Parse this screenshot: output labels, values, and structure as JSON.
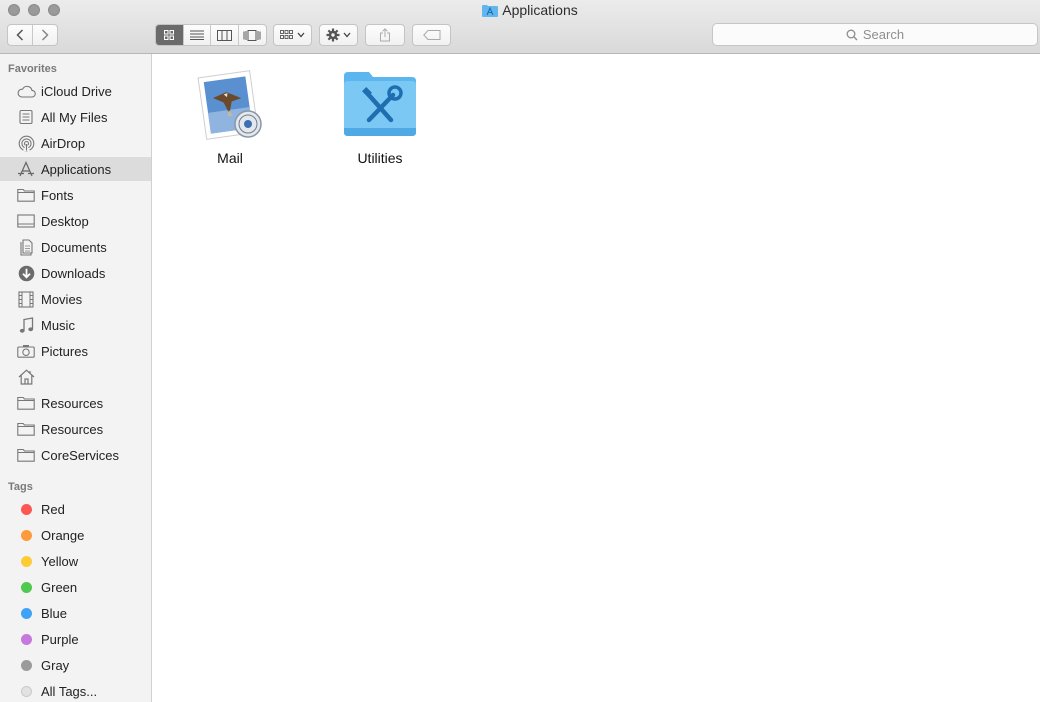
{
  "window": {
    "title": "Applications"
  },
  "toolbar": {
    "search_placeholder": "Search",
    "view_modes": [
      "icon-view",
      "list-view",
      "column-view",
      "cover-flow-view"
    ]
  },
  "sidebar": {
    "favorites_title": "Favorites",
    "favorites": [
      {
        "label": "iCloud Drive",
        "icon": "cloud-icon"
      },
      {
        "label": "All My Files",
        "icon": "all-files-icon"
      },
      {
        "label": "AirDrop",
        "icon": "airdrop-icon"
      },
      {
        "label": "Applications",
        "icon": "applications-icon",
        "selected": true
      },
      {
        "label": "Fonts",
        "icon": "folder-icon"
      },
      {
        "label": "Desktop",
        "icon": "desktop-icon"
      },
      {
        "label": "Documents",
        "icon": "documents-icon"
      },
      {
        "label": "Downloads",
        "icon": "downloads-icon"
      },
      {
        "label": "Movies",
        "icon": "movies-icon"
      },
      {
        "label": "Music",
        "icon": "music-icon"
      },
      {
        "label": "Pictures",
        "icon": "pictures-icon"
      },
      {
        "label": "",
        "icon": "home-icon"
      },
      {
        "label": "Resources",
        "icon": "folder-icon"
      },
      {
        "label": "Resources",
        "icon": "folder-icon"
      },
      {
        "label": "CoreServices",
        "icon": "folder-icon"
      }
    ],
    "tags_title": "Tags",
    "tags": [
      {
        "label": "Red",
        "color": "#fc5753"
      },
      {
        "label": "Orange",
        "color": "#fd9a3a"
      },
      {
        "label": "Yellow",
        "color": "#fdcc35"
      },
      {
        "label": "Green",
        "color": "#4fc94e"
      },
      {
        "label": "Blue",
        "color": "#3ea3f7"
      },
      {
        "label": "Purple",
        "color": "#c679dc"
      },
      {
        "label": "Gray",
        "color": "#9b9b9b"
      },
      {
        "label": "All Tags...",
        "color": "#e2e2e2"
      }
    ]
  },
  "files": [
    {
      "name": "Mail",
      "icon": "mail-app-icon"
    },
    {
      "name": "Utilities",
      "icon": "utilities-folder-icon"
    }
  ]
}
